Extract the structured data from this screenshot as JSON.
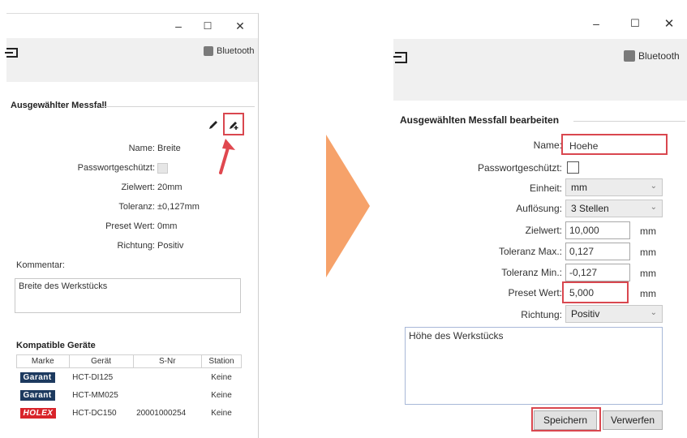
{
  "left": {
    "window": {
      "minimize": "–",
      "maximize": "☐",
      "close": "✕"
    },
    "toolbar": {
      "bluetooth_label": "Bluetooth"
    },
    "section_title": "Ausgewählter Messfall",
    "fields": [
      {
        "label": "Name:",
        "value": "Breite"
      },
      {
        "label": "Passwortgeschützt:",
        "value": ""
      },
      {
        "label": "Zielwert:",
        "value": "20mm"
      },
      {
        "label": "Toleranz:",
        "value": "±0,127mm"
      },
      {
        "label": "Preset Wert:",
        "value": "0mm"
      },
      {
        "label": "Richtung:",
        "value": "Positiv"
      }
    ],
    "comment_label": "Kommentar:",
    "comment_value": "Breite des Werkstücks",
    "devices_title": "Kompatible Geräte",
    "devices_headers": [
      "Marke",
      "Gerät",
      "S-Nr",
      "Station"
    ],
    "devices_rows": [
      {
        "brand": "Garant",
        "device": "HCT-DI125",
        "serial": "",
        "station": "Keine"
      },
      {
        "brand": "Garant",
        "device": "HCT-MM025",
        "serial": "",
        "station": "Keine"
      },
      {
        "brand": "HOLEX",
        "device": "HCT-DC150",
        "serial": "20001000254",
        "station": "Keine"
      }
    ]
  },
  "right": {
    "window": {
      "minimize": "–",
      "maximize": "☐",
      "close": "✕"
    },
    "toolbar": {
      "bluetooth_label": "Bluetooth"
    },
    "section_title": "Ausgewählten Messfall bearbeiten",
    "name_label": "Name:",
    "name_value": "Hoehe",
    "password_label": "Passwortgeschützt:",
    "einheit_label": "Einheit:",
    "einheit_value": "mm",
    "aufloesung_label": "Auflösung:",
    "aufloesung_value": "3 Stellen",
    "zielwert_label": "Zielwert:",
    "zielwert_value": "10,000",
    "tol_max_label": "Toleranz Max.:",
    "tol_max_value": "0,127",
    "tol_min_label": "Toleranz Min.:",
    "tol_min_value": "-0,127",
    "preset_label": "Preset Wert:",
    "preset_value": "5,000",
    "richtung_label": "Richtung:",
    "richtung_value": "Positiv",
    "unit": "mm",
    "comment_value": "Höhe des Werkstücks",
    "save_label": "Speichern",
    "discard_label": "Verwerfen"
  },
  "colors": {
    "highlight": "#d9474f",
    "arrow": "#f6a26a",
    "garant": "#1d3a5f",
    "holex": "#d8232a"
  }
}
